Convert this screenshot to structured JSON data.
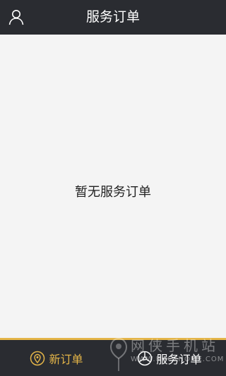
{
  "header": {
    "title": "服务订单",
    "profile_icon": "user-icon"
  },
  "main": {
    "empty_message": "暂无服务订单"
  },
  "tabbar": {
    "accent_color": "#e4b548",
    "tabs": [
      {
        "label": "新订单",
        "icon": "location-pin-icon",
        "active": true
      },
      {
        "label": "服务订单",
        "icon": "steering-wheel-icon",
        "active": false
      }
    ]
  },
  "watermark": {
    "text_cn": "网侠手机站",
    "url": "WWW.HACKHOME.COM"
  }
}
